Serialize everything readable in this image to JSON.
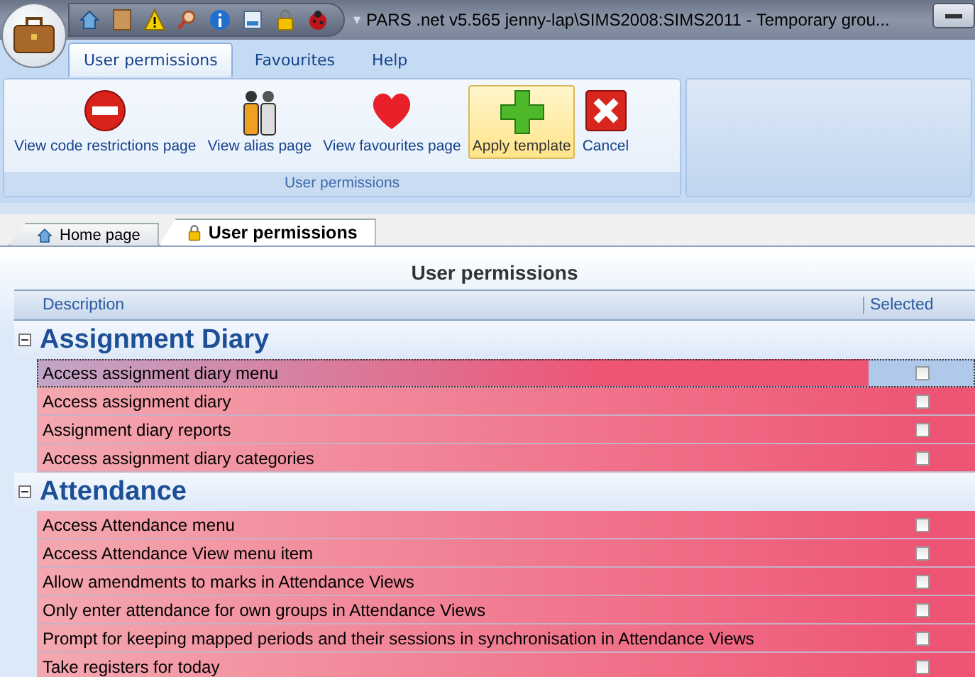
{
  "window": {
    "title": "PARS .net v5.565  jenny-lap\\SIMS2008:SIMS2011 - Temporary grou...",
    "dropdown": "▾"
  },
  "ribbon": {
    "tabs": [
      {
        "label": "User permissions",
        "selected": true
      },
      {
        "label": "Favourites",
        "selected": false
      },
      {
        "label": "Help",
        "selected": false
      }
    ],
    "buttons": [
      {
        "label": "View code restrictions page",
        "kind": "no-entry",
        "selected": false
      },
      {
        "label": "View alias page",
        "kind": "people",
        "selected": false
      },
      {
        "label": "View favourites page",
        "kind": "heart",
        "selected": false
      },
      {
        "label": "Apply template",
        "kind": "plus",
        "selected": true
      },
      {
        "label": "Cancel",
        "kind": "cancel",
        "selected": false
      }
    ],
    "group_label": "User permissions"
  },
  "doc_tabs": [
    {
      "label": "Home page",
      "kind": "home",
      "selected": false
    },
    {
      "label": "User permissions",
      "kind": "lock",
      "selected": true
    }
  ],
  "page_title": "User permissions",
  "table": {
    "columns": [
      "Description",
      "Selected"
    ],
    "groups": [
      {
        "name": "Assignment Diary",
        "expanded": true,
        "rows": [
          {
            "label": "Access assignment diary menu",
            "selected": true,
            "checked": false
          },
          {
            "label": "Access assignment diary",
            "selected": false,
            "checked": false
          },
          {
            "label": "Assignment diary reports",
            "selected": false,
            "checked": false
          },
          {
            "label": "Access assignment diary categories",
            "selected": false,
            "checked": false
          }
        ]
      },
      {
        "name": "Attendance",
        "expanded": true,
        "rows": [
          {
            "label": "Access Attendance menu",
            "selected": false,
            "checked": false
          },
          {
            "label": "Access Attendance View menu item",
            "selected": false,
            "checked": false
          },
          {
            "label": "Allow amendments to marks in Attendance Views",
            "selected": false,
            "checked": false
          },
          {
            "label": "Only enter attendance for own groups in Attendance Views",
            "selected": false,
            "checked": false
          },
          {
            "label": "Prompt for keeping mapped periods and their sessions in synchronisation in Attendance Views",
            "selected": false,
            "checked": false
          },
          {
            "label": "Take registers for today",
            "selected": false,
            "checked": false
          }
        ]
      }
    ]
  }
}
